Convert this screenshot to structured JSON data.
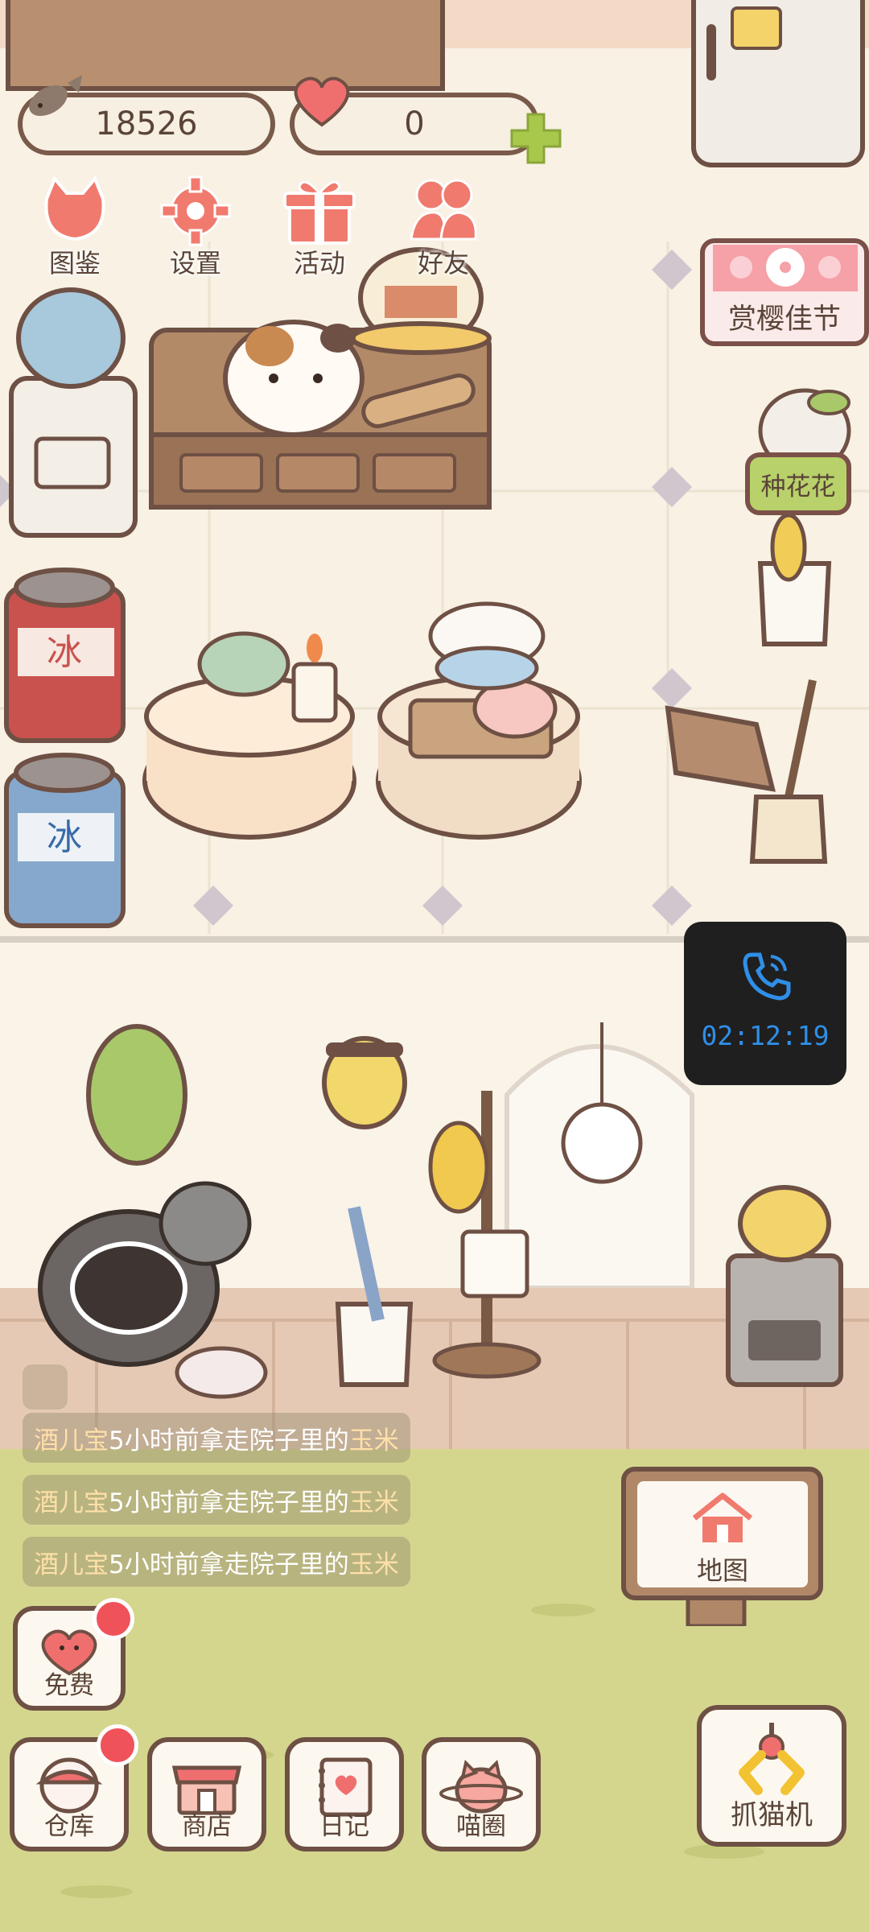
{
  "currency": {
    "fish_count": "18526",
    "heart_count": "0"
  },
  "top_menu": [
    {
      "label": "图鉴",
      "icon": "cat-book-icon"
    },
    {
      "label": "设置",
      "icon": "gear-icon"
    },
    {
      "label": "活动",
      "icon": "gift-icon"
    },
    {
      "label": "好友",
      "icon": "friends-icon"
    }
  ],
  "events": {
    "sakura_label": "赏樱佳节",
    "plant_label": "种花花"
  },
  "call_overlay": {
    "timer": "02:12:19",
    "icon": "phone-icon"
  },
  "activity_feed": [
    {
      "name": "酒儿宝",
      "text": "5小时前拿走院子里的",
      "item": "玉米"
    },
    {
      "name": "酒儿宝",
      "text": "5小时前拿走院子里的",
      "item": "玉米"
    },
    {
      "name": "酒儿宝",
      "text": "5小时前拿走院子里的",
      "item": "玉米"
    }
  ],
  "map_button": {
    "label": "地图",
    "icon": "house-icon"
  },
  "free_button": {
    "label": "免费",
    "icon": "heart-icon"
  },
  "bottom_nav": [
    {
      "label": "仓库",
      "icon": "storage-icon"
    },
    {
      "label": "商店",
      "icon": "shop-icon"
    },
    {
      "label": "日记",
      "icon": "diary-icon"
    },
    {
      "label": "喵圈",
      "icon": "planet-cat-icon"
    }
  ],
  "claw_button": {
    "label": "抓猫机",
    "icon": "claw-icon"
  },
  "colors": {
    "floor": "#f7efe0",
    "grass": "#d4d68e",
    "wood_wall": "#e6c9b4",
    "outline": "#6e5044",
    "badge": "#f0525a",
    "call_bg": "#1f1f1f",
    "call_text": "#2f8fe8",
    "tag_green": "#b8d16a",
    "tag_pink": "#f6a0a8"
  }
}
